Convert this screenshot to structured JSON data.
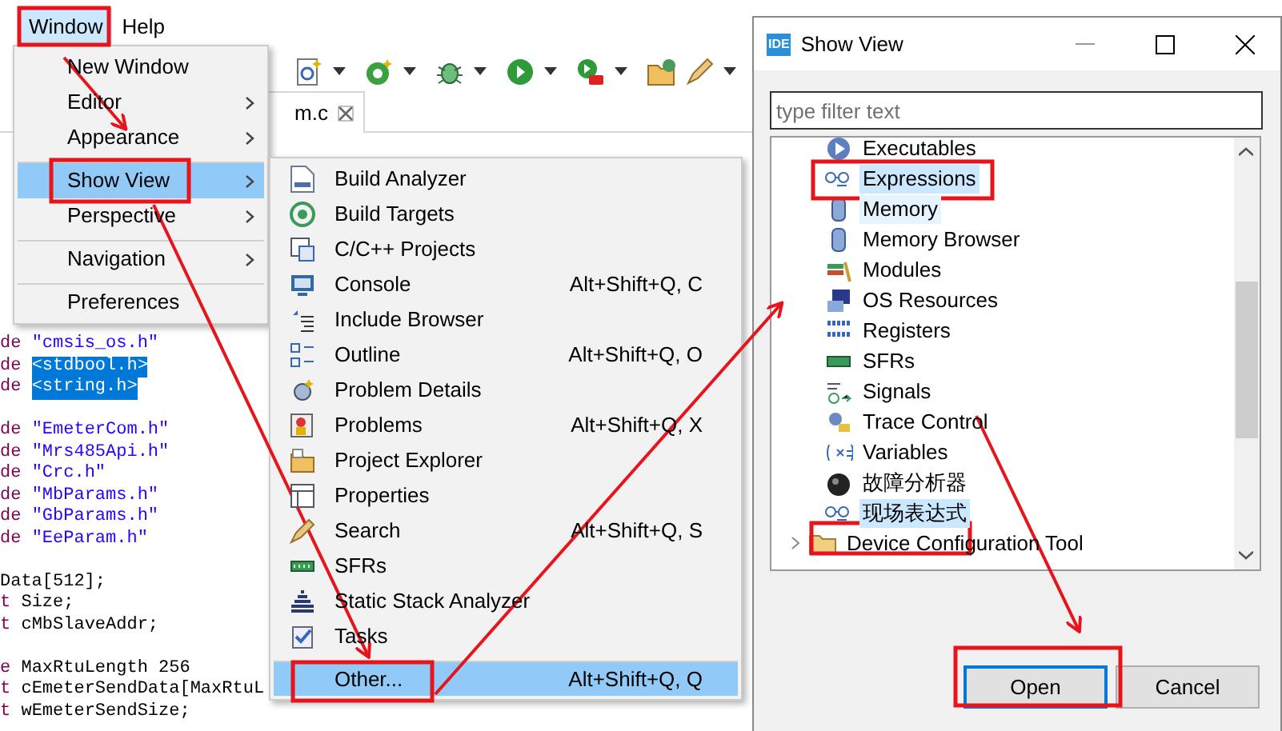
{
  "menubar": [
    {
      "label": "Window",
      "selected": true
    },
    {
      "label": "Help",
      "selected": false
    }
  ],
  "editor_tab": {
    "label": "m.c"
  },
  "code_blocks": [
    [
      {
        "keyword": "de",
        "string": "\"cmsis_os.h\"",
        "selected": false
      },
      {
        "keyword": "de",
        "text": "<stdbool.h>",
        "selected": true
      },
      {
        "keyword": "de",
        "text": "<string.h>",
        "selected": true
      }
    ],
    [
      {
        "keyword": "de",
        "string": "\"EmeterCom.h\"",
        "selected": false
      },
      {
        "keyword": "de",
        "string": "\"Mrs485Api.h\"",
        "selected": false
      },
      {
        "keyword": "de",
        "string": "\"Crc.h\"",
        "selected": false
      },
      {
        "keyword": "de",
        "string": "\"MbParams.h\"",
        "selected": false
      },
      {
        "keyword": "de",
        "string": "\"GbParams.h\"",
        "selected": false
      },
      {
        "keyword": "de",
        "string": "\"EeParam.h\"",
        "selected": false
      }
    ],
    [
      {
        "text": "Data[512];",
        "selected": false
      },
      {
        "keyword": "t",
        "text": "Size;",
        "selected": false
      },
      {
        "keyword": "t",
        "text": "cMbSlaveAddr;",
        "selected": false
      }
    ],
    [
      {
        "keyword": "e",
        "text": "MaxRtuLength 256",
        "selected": false
      },
      {
        "keyword": "t",
        "text": "cEmeterSendData[MaxRtuL",
        "selected": false
      },
      {
        "keyword": "t",
        "text": "wEmeterSendSize;",
        "selected": false
      }
    ]
  ],
  "window_menu": [
    {
      "label": "New Window",
      "submenu": false,
      "selected": false,
      "separator_before": false
    },
    {
      "label": "Editor",
      "submenu": true,
      "selected": false,
      "separator_before": false
    },
    {
      "label": "Appearance",
      "submenu": true,
      "selected": false,
      "separator_before": false
    },
    {
      "label": "Show View",
      "submenu": true,
      "selected": true,
      "separator_before": true
    },
    {
      "label": "Perspective",
      "submenu": true,
      "selected": false,
      "separator_before": false
    },
    {
      "label": "Navigation",
      "submenu": true,
      "selected": false,
      "separator_before": true
    },
    {
      "label": "Preferences",
      "submenu": false,
      "selected": false,
      "separator_before": true
    }
  ],
  "show_view_menu": [
    {
      "label": "Build Analyzer",
      "selected": false,
      "separator_before": false
    },
    {
      "label": "Build Targets",
      "selected": false,
      "separator_before": false
    },
    {
      "label": "C/C++ Projects",
      "selected": false,
      "separator_before": false
    },
    {
      "label": "Console",
      "shortcut": "Alt+Shift+Q, C",
      "selected": false,
      "separator_before": false
    },
    {
      "label": "Include Browser",
      "selected": false,
      "separator_before": false
    },
    {
      "label": "Outline",
      "shortcut": "Alt+Shift+Q, O",
      "selected": false,
      "separator_before": false
    },
    {
      "label": "Problem Details",
      "selected": false,
      "separator_before": false
    },
    {
      "label": "Problems",
      "shortcut": "Alt+Shift+Q, X",
      "selected": false,
      "separator_before": false
    },
    {
      "label": "Project Explorer",
      "selected": false,
      "separator_before": false
    },
    {
      "label": "Properties",
      "selected": false,
      "separator_before": false
    },
    {
      "label": "Search",
      "shortcut": "Alt+Shift+Q, S",
      "selected": false,
      "separator_before": false
    },
    {
      "label": "SFRs",
      "selected": false,
      "separator_before": false
    },
    {
      "label": "Static Stack Analyzer",
      "selected": false,
      "separator_before": false
    },
    {
      "label": "Tasks",
      "selected": false,
      "separator_before": false
    },
    {
      "label": "Other...",
      "shortcut": "Alt+Shift+Q, Q",
      "selected": true,
      "separator_before": true
    }
  ],
  "dialog": {
    "icon_label": "IDE",
    "title": "Show View",
    "filter": {
      "placeholder": "type filter text"
    },
    "items": [
      {
        "label": "Executables",
        "selected": false,
        "hovered": false
      },
      {
        "label": "Expressions",
        "selected": true,
        "hovered": false
      },
      {
        "label": "Memory",
        "selected": false,
        "hovered": true
      },
      {
        "label": "Memory Browser",
        "selected": false,
        "hovered": false
      },
      {
        "label": "Modules",
        "selected": false,
        "hovered": false
      },
      {
        "label": "OS Resources",
        "selected": false,
        "hovered": false
      },
      {
        "label": "Registers",
        "selected": false,
        "hovered": false
      },
      {
        "label": "SFRs",
        "selected": false,
        "hovered": false
      },
      {
        "label": "Signals",
        "selected": false,
        "hovered": false
      },
      {
        "label": "Trace Control",
        "selected": false,
        "hovered": false
      },
      {
        "label": "Variables",
        "selected": false,
        "hovered": false
      },
      {
        "label": "故障分析器",
        "selected": false,
        "hovered": false
      },
      {
        "label": "现场表达式",
        "selected": true,
        "hovered": false
      }
    ],
    "category": {
      "label": "Device Configuration Tool",
      "expanded": false
    },
    "buttons": [
      {
        "label": "Open",
        "default": true
      },
      {
        "label": "Cancel",
        "default": false
      }
    ]
  }
}
